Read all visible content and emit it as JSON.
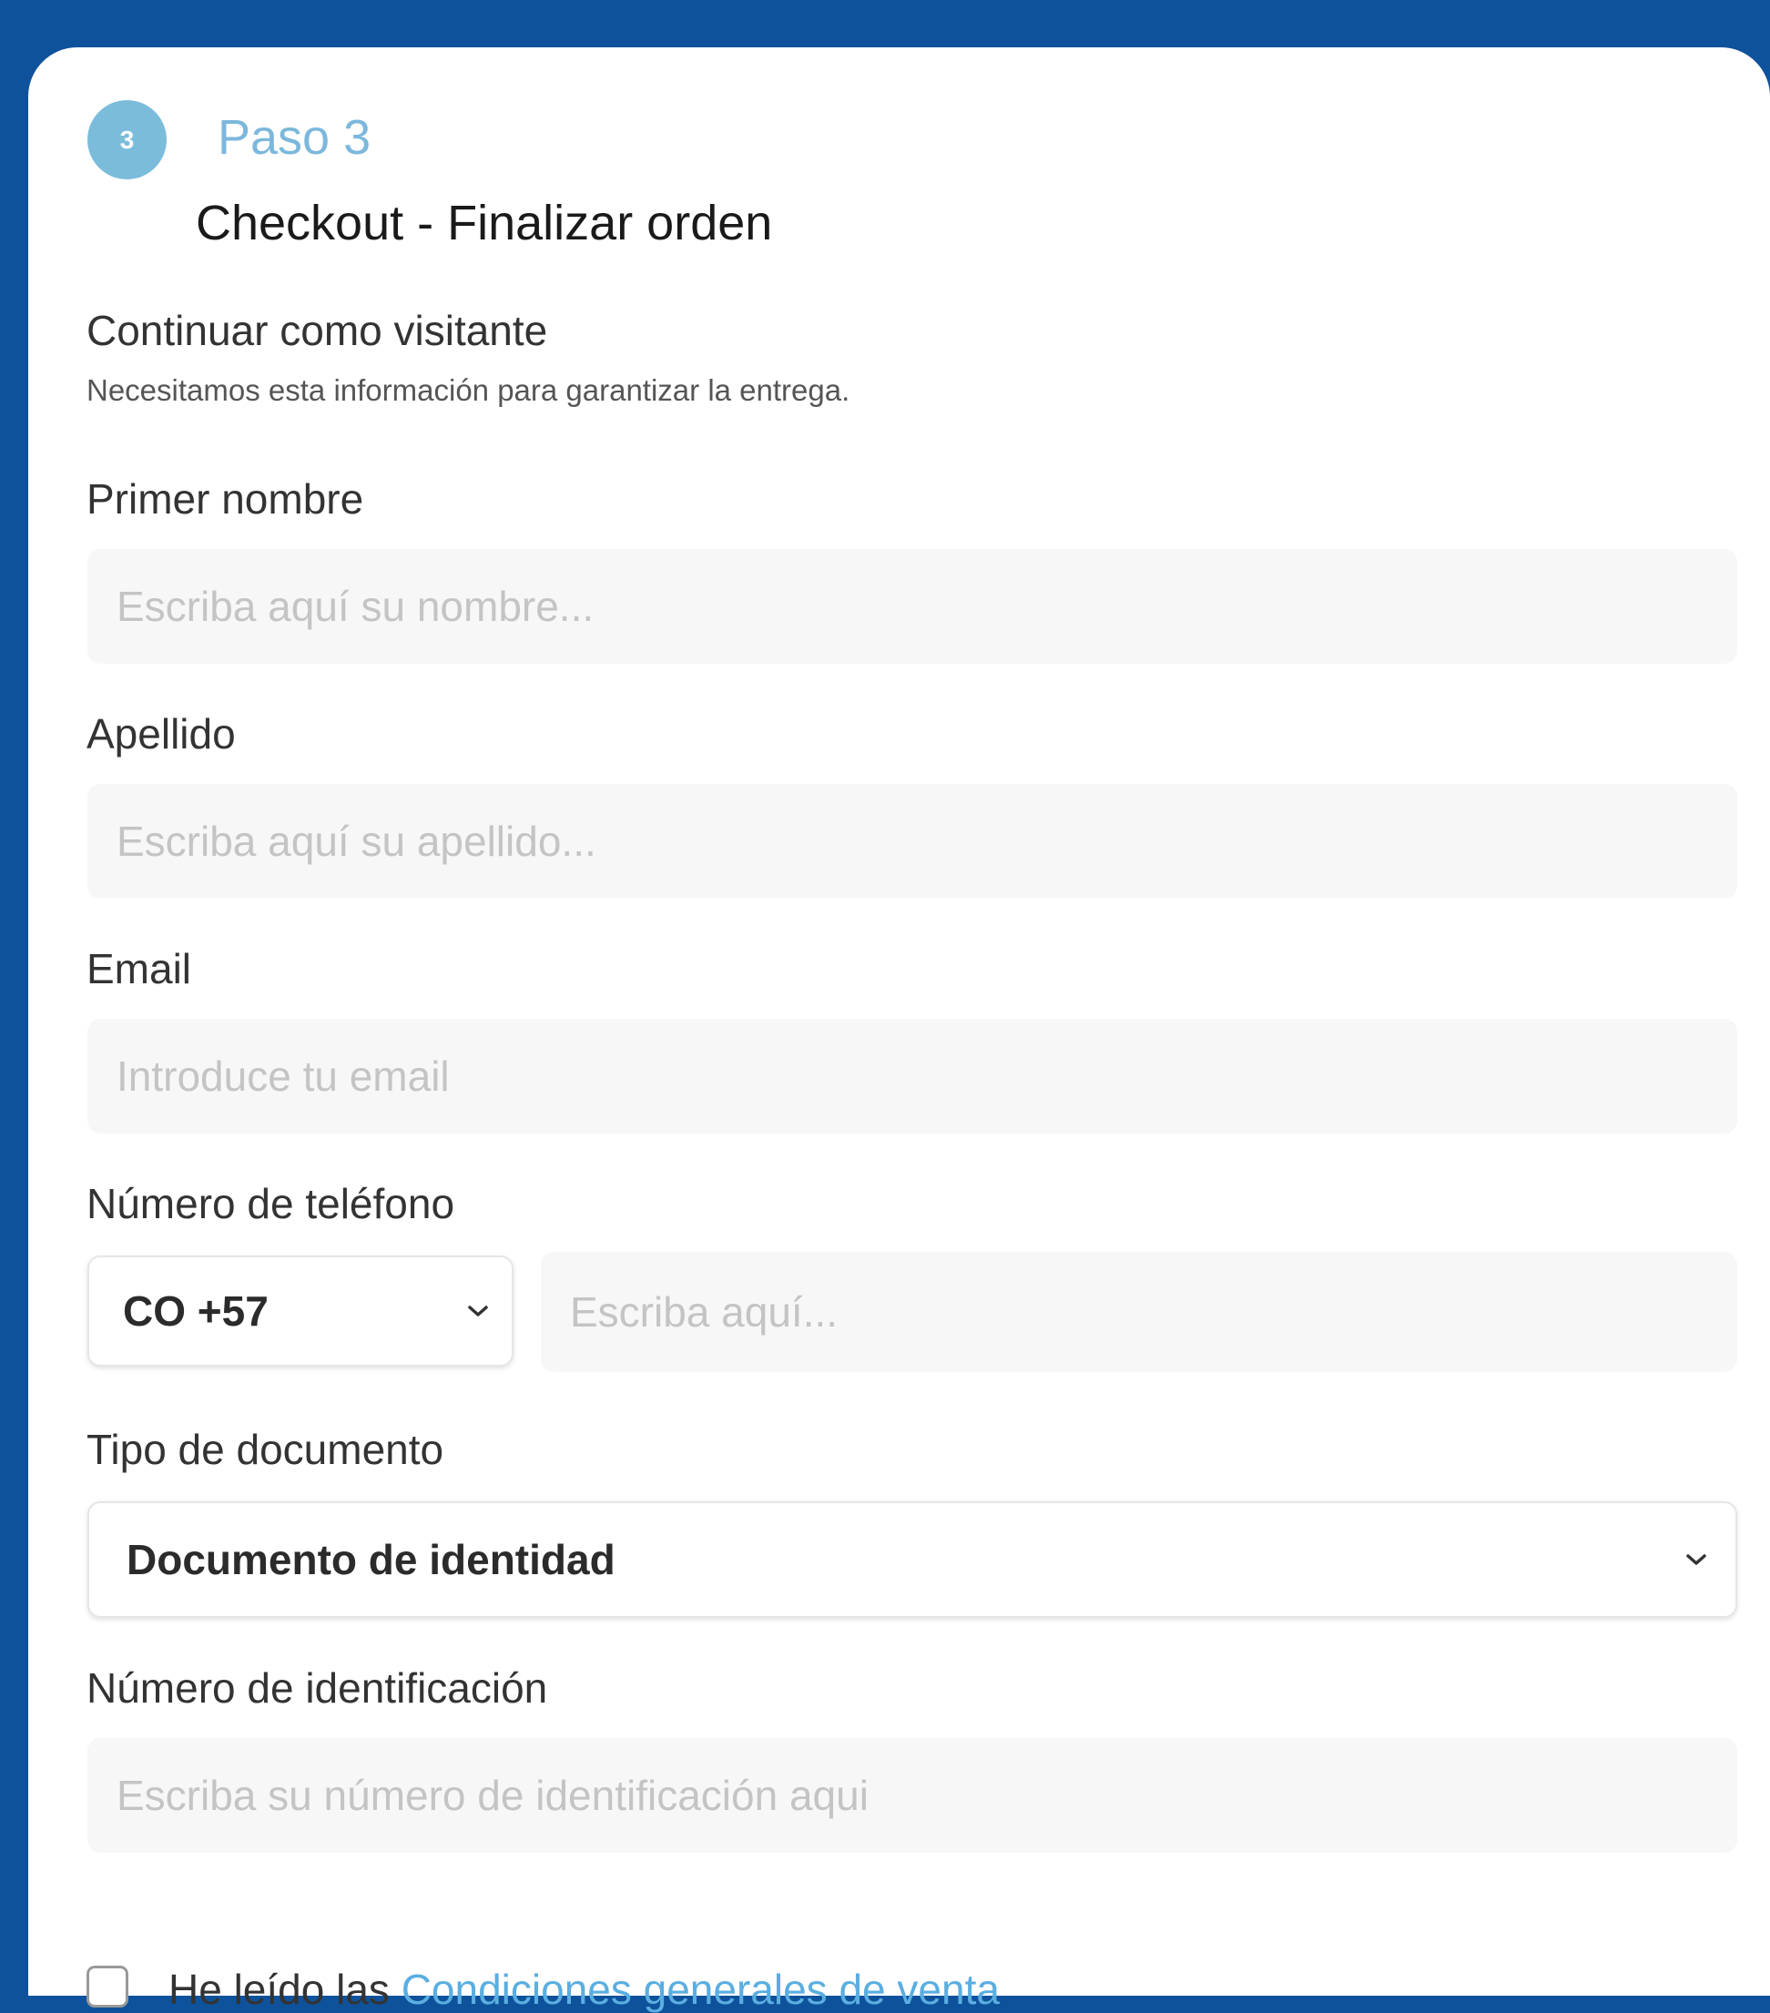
{
  "step": {
    "number": "3",
    "label": "Paso 3",
    "title": "Checkout - Finalizar orden"
  },
  "section": {
    "title": "Continuar como visitante",
    "subtitle": "Necesitamos esta información para garantizar la entrega."
  },
  "fields": {
    "first_name": {
      "label": "Primer nombre",
      "placeholder": "Escriba aquí su nombre...",
      "value": ""
    },
    "last_name": {
      "label": "Apellido",
      "placeholder": "Escriba aquí su apellido...",
      "value": ""
    },
    "email": {
      "label": "Email",
      "placeholder": "Introduce tu email",
      "value": ""
    },
    "phone": {
      "label": "Número de teléfono",
      "country_code": "CO +57",
      "placeholder": "Escriba aquí...",
      "value": ""
    },
    "document_type": {
      "label": "Tipo de documento",
      "selected": "Documento de identidad"
    },
    "document_number": {
      "label": "Número de identificación",
      "placeholder": "Escriba su número de identificación aqui",
      "value": ""
    }
  },
  "terms": {
    "prefix": "He leído las ",
    "link_text": "Condiciones generales de venta",
    "checked": false
  },
  "colors": {
    "header_background": "#0f529c",
    "accent": "#7bbcdb",
    "link": "#5aaee0",
    "input_background": "#f7f7f7"
  },
  "icons": {
    "select_chevron": "chevron-down-icon"
  }
}
